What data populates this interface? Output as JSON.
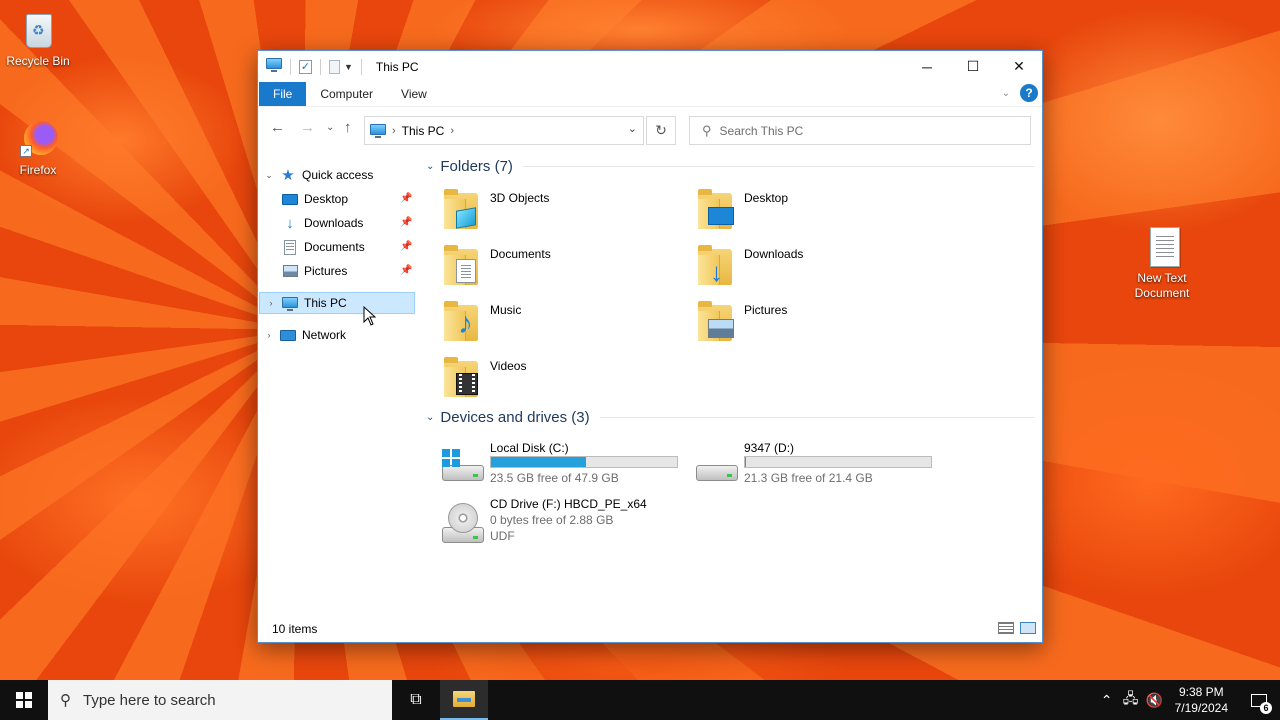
{
  "desktop": {
    "icons": [
      {
        "label": "Recycle Bin",
        "icon": "recycle-bin-icon"
      },
      {
        "label": "Firefox",
        "icon": "firefox-icon"
      },
      {
        "label": "New Text Document",
        "icon": "text-document-icon"
      }
    ]
  },
  "window": {
    "title": "This PC",
    "ribbon_tabs": [
      "File",
      "Computer",
      "View"
    ],
    "address": {
      "crumb": "This PC"
    },
    "search": {
      "placeholder": "Search This PC"
    },
    "sidebar": {
      "quick_access": "Quick access",
      "quick_items": [
        "Desktop",
        "Downloads",
        "Documents",
        "Pictures"
      ],
      "this_pc": "This PC",
      "network": "Network"
    },
    "folders": {
      "header": "Folders (7)",
      "items": [
        "3D Objects",
        "Desktop",
        "Documents",
        "Downloads",
        "Music",
        "Pictures",
        "Videos"
      ]
    },
    "drives": {
      "header": "Devices and drives (3)",
      "items": [
        {
          "name": "Local Disk (C:)",
          "free": "23.5 GB free of 47.9 GB",
          "used_fraction": 0.51
        },
        {
          "name": "9347 (D:)",
          "free": "21.3 GB free of 21.4 GB",
          "used_fraction": 0.005
        },
        {
          "name": "CD Drive (F:) HBCD_PE_x64",
          "free": "0 bytes free of 2.88 GB",
          "fs": "UDF"
        }
      ]
    },
    "status": "10 items"
  },
  "taskbar": {
    "search_placeholder": "Type here to search",
    "time": "9:38 PM",
    "date": "7/19/2024",
    "notification_count": "6"
  },
  "colors": {
    "accent": "#1979ca",
    "selection": "#cce8ff",
    "drive_bar": "#26a0da",
    "group_header": "#1e395b"
  }
}
